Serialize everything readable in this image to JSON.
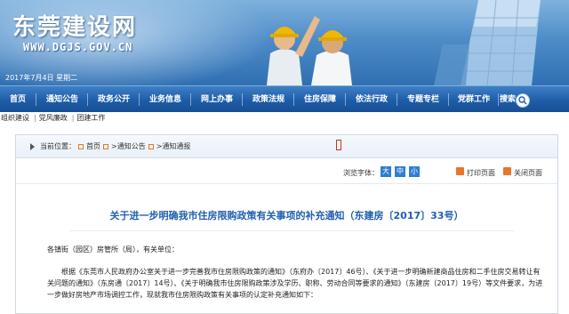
{
  "site": {
    "brand": "东莞建设网",
    "url": "WWW.DGJS.GOV.CN",
    "date": "2017年7月4日 星期二"
  },
  "colors": {
    "nav_blue": "#1e5da8",
    "title_blue": "#1f5fb0",
    "accent_orange": "#e8762b"
  },
  "nav": {
    "items": [
      "首页",
      "通知公告",
      "政务公开",
      "业务信息",
      "网上办事",
      "政策法规",
      "住房保障",
      "依法行政",
      "专题专栏",
      "党群工作"
    ],
    "search_label": "搜索"
  },
  "subnav": {
    "items": [
      "组织建设",
      "党风廉政",
      "团建工作"
    ]
  },
  "breadcrumb": {
    "prefix": "当前位置：",
    "items": [
      "首页",
      ">通知公告",
      ">通知通报"
    ]
  },
  "toolbar": {
    "font_label": "浏览字体：",
    "font_sizes": [
      "大",
      "中",
      "小"
    ],
    "print_label": "打印页面",
    "close_label": "关闭页面"
  },
  "article": {
    "title": "关于进一步明确我市住房限购政策有关事项的补充通知（东建房〔2017〕33号）",
    "salutation": "各镇街（园区）房管所（局），有关单位：",
    "paragraph1": "根据《东莞市人民政府办公室关于进一步完善我市住房限购政策的通知》（东府办〔2017〕46号）、《关于进一步明确新建商品住房和二手住房交易转让有关问题的通知》（东房通〔2017〕14号）、《关于明确我市住房限购政策涉及学历、职称、劳动合同等要求的通知》（东建房〔2017〕19号）等文件要求，为进一步做好房地产市场调控工作，现就我市住房限购政策有关事项的认定补充通知如下："
  }
}
